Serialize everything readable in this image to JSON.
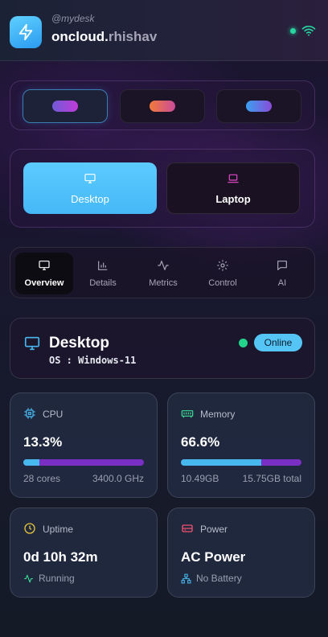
{
  "header": {
    "handle": "@mydesk",
    "brand_main": "oncloud.",
    "brand_user": "rhishav",
    "status_color": "#26d7a0"
  },
  "themes": [
    {
      "name": "purple",
      "gradient": [
        "#6f5bd6",
        "#c03bd8"
      ],
      "active": true
    },
    {
      "name": "orange",
      "gradient": [
        "#f27a3a",
        "#c94b9a"
      ],
      "active": false
    },
    {
      "name": "blue",
      "gradient": [
        "#3aa0f0",
        "#8a4cd8"
      ],
      "active": false
    }
  ],
  "devices": {
    "desktop_label": "Desktop",
    "laptop_label": "Laptop",
    "selected": "Desktop"
  },
  "tabs": [
    {
      "label": "Overview",
      "icon": "monitor-icon",
      "active": true
    },
    {
      "label": "Details",
      "icon": "bar-chart-icon",
      "active": false
    },
    {
      "label": "Metrics",
      "icon": "activity-icon",
      "active": false
    },
    {
      "label": "Control",
      "icon": "gear-icon",
      "active": false
    },
    {
      "label": "AI",
      "icon": "message-icon",
      "active": false
    }
  ],
  "device_card": {
    "title": "Desktop",
    "os": "OS : Windows-11",
    "status": "Online"
  },
  "stats": {
    "cpu": {
      "label": "CPU",
      "value": "13.3%",
      "percent": 13.3,
      "cores": "28 cores",
      "clock": "3400.0 GHz"
    },
    "memory": {
      "label": "Memory",
      "value": "66.6%",
      "percent": 66.6,
      "used": "10.49GB",
      "total": "15.75GB total"
    },
    "uptime": {
      "label": "Uptime",
      "value": "0d 10h 32m",
      "state": "Running"
    },
    "power": {
      "label": "Power",
      "value": "AC Power",
      "battery": "No Battery"
    }
  },
  "colors": {
    "accent_blue": "#47b8ee",
    "accent_purple": "#7a2fc4",
    "online_green": "#22d38a"
  }
}
